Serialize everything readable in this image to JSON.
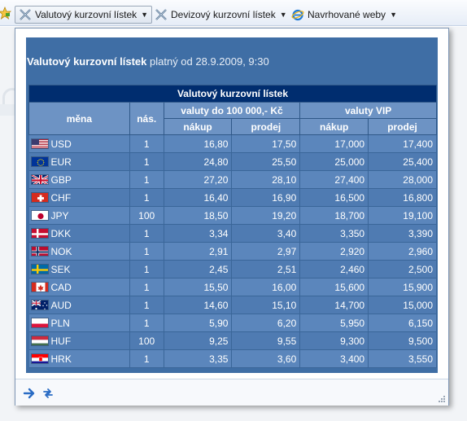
{
  "toolbar": {
    "items": [
      {
        "label": "Valutový kurzovní lístek",
        "icon": "currency-icon"
      },
      {
        "label": "Devizový kurzovní lístek",
        "icon": "currency-icon"
      },
      {
        "label": "Navrhované weby",
        "icon": "ie-icon"
      }
    ]
  },
  "popup": {
    "title_bold": "Valutový kurzovní lístek",
    "title_rest": " platný od 28.9.2009, 9:30",
    "table": {
      "caption": "Valutový kurzovní lístek",
      "col_currency": "měna",
      "col_qty": "nás.",
      "group1": "valuty do 100 000,- Kč",
      "group2": "valuty VIP",
      "buy": "nákup",
      "sell": "prodej",
      "rows": [
        {
          "code": "USD",
          "qty": "1",
          "buy": "16,80",
          "sell": "17,50",
          "vip_buy": "17,000",
          "vip_sell": "17,400"
        },
        {
          "code": "EUR",
          "qty": "1",
          "buy": "24,80",
          "sell": "25,50",
          "vip_buy": "25,000",
          "vip_sell": "25,400"
        },
        {
          "code": "GBP",
          "qty": "1",
          "buy": "27,20",
          "sell": "28,10",
          "vip_buy": "27,400",
          "vip_sell": "28,000"
        },
        {
          "code": "CHF",
          "qty": "1",
          "buy": "16,40",
          "sell": "16,90",
          "vip_buy": "16,500",
          "vip_sell": "16,800"
        },
        {
          "code": "JPY",
          "qty": "100",
          "buy": "18,50",
          "sell": "19,20",
          "vip_buy": "18,700",
          "vip_sell": "19,100"
        },
        {
          "code": "DKK",
          "qty": "1",
          "buy": "3,34",
          "sell": "3,40",
          "vip_buy": "3,350",
          "vip_sell": "3,390"
        },
        {
          "code": "NOK",
          "qty": "1",
          "buy": "2,91",
          "sell": "2,97",
          "vip_buy": "2,920",
          "vip_sell": "2,960"
        },
        {
          "code": "SEK",
          "qty": "1",
          "buy": "2,45",
          "sell": "2,51",
          "vip_buy": "2,460",
          "vip_sell": "2,500"
        },
        {
          "code": "CAD",
          "qty": "1",
          "buy": "15,50",
          "sell": "16,00",
          "vip_buy": "15,600",
          "vip_sell": "15,900"
        },
        {
          "code": "AUD",
          "qty": "1",
          "buy": "14,60",
          "sell": "15,10",
          "vip_buy": "14,700",
          "vip_sell": "15,000"
        },
        {
          "code": "PLN",
          "qty": "1",
          "buy": "5,90",
          "sell": "6,20",
          "vip_buy": "5,950",
          "vip_sell": "6,150"
        },
        {
          "code": "HUF",
          "qty": "100",
          "buy": "9,25",
          "sell": "9,55",
          "vip_buy": "9,300",
          "vip_sell": "9,500"
        },
        {
          "code": "HRK",
          "qty": "1",
          "buy": "3,35",
          "sell": "3,60",
          "vip_buy": "3,400",
          "vip_sell": "3,550"
        }
      ]
    }
  },
  "colors": {
    "panel": "#3f6ea5",
    "caption": "#002d6f",
    "header": "#6d93c4",
    "row_odd": "#5b86bc",
    "row_even": "#4f7bb2"
  }
}
